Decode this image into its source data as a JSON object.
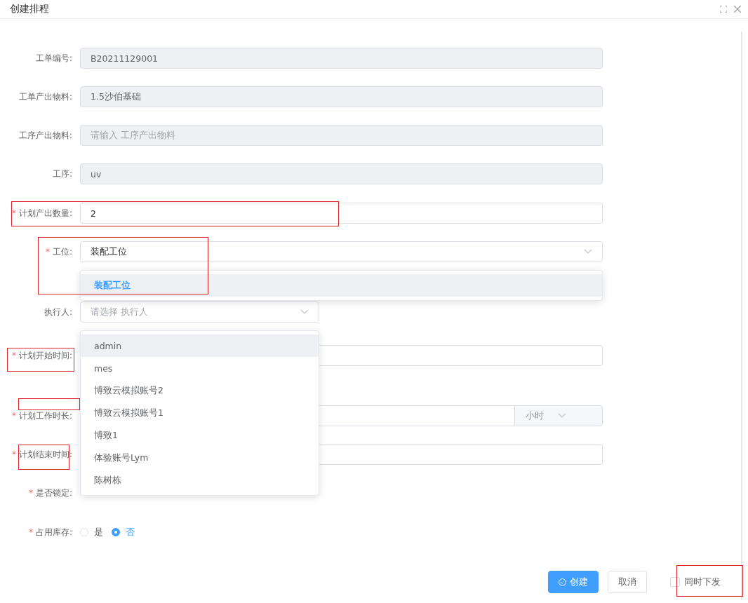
{
  "dialog": {
    "title": "创建排程"
  },
  "required_mark": "*",
  "fields": [
    {
      "kind": "input",
      "label": "工单编号:",
      "required": false,
      "disabled": true,
      "value": "B20211129001"
    },
    {
      "kind": "input",
      "label": "工单产出物料:",
      "required": false,
      "disabled": true,
      "value": "1.5沙伯基础"
    },
    {
      "kind": "input",
      "label": "工序产出物料:",
      "required": false,
      "disabled": true,
      "placeholder": "请输入 工序产出物料"
    },
    {
      "kind": "input",
      "label": "工序:",
      "required": false,
      "disabled": true,
      "value": "uv"
    },
    {
      "kind": "input",
      "label": "计划产出数量:",
      "required": true,
      "disabled": false,
      "value": "2"
    },
    {
      "kind": "select",
      "label": "工位:",
      "required": true,
      "disabled": false,
      "value": "装配工位",
      "dropdown": [
        {
          "label": "装配工位",
          "selected": true,
          "highlighted": true
        }
      ]
    },
    {
      "kind": "select",
      "label": "执行人:",
      "required": false,
      "disabled": false,
      "placeholder": "请选择 执行人",
      "narrow": true,
      "dropdown": [
        {
          "label": "admin",
          "selected": false,
          "highlighted": true
        },
        {
          "label": "mes",
          "selected": false,
          "highlighted": false
        },
        {
          "label": "博致云模拟账号2",
          "selected": false,
          "highlighted": false
        },
        {
          "label": "博致云模拟账号1",
          "selected": false,
          "highlighted": false
        },
        {
          "label": "博致1",
          "selected": false,
          "highlighted": false
        },
        {
          "label": "体验账号Lym",
          "selected": false,
          "highlighted": false
        },
        {
          "label": "陈树栋",
          "selected": false,
          "highlighted": false
        }
      ]
    },
    {
      "kind": "input",
      "label": "计划开始时间:",
      "required": true,
      "disabled": false
    },
    {
      "kind": "unit",
      "label": "计划工作时长:",
      "required": true,
      "disabled": false,
      "unit": "小时"
    },
    {
      "kind": "input",
      "label": "计划结束时间:",
      "required": true,
      "disabled": false
    },
    {
      "kind": "radio",
      "label": "是否锁定:",
      "required": true
    },
    {
      "kind": "radio",
      "label": "占用库存:",
      "required": true,
      "options": [
        {
          "label": "是",
          "selected": false
        },
        {
          "label": "否",
          "selected": true
        }
      ]
    }
  ],
  "buttons": [
    {
      "kind": "primary",
      "label": "创建"
    },
    {
      "kind": "default",
      "label": "取消"
    }
  ],
  "checkbox": {
    "label": "同时下发",
    "checked": false
  }
}
